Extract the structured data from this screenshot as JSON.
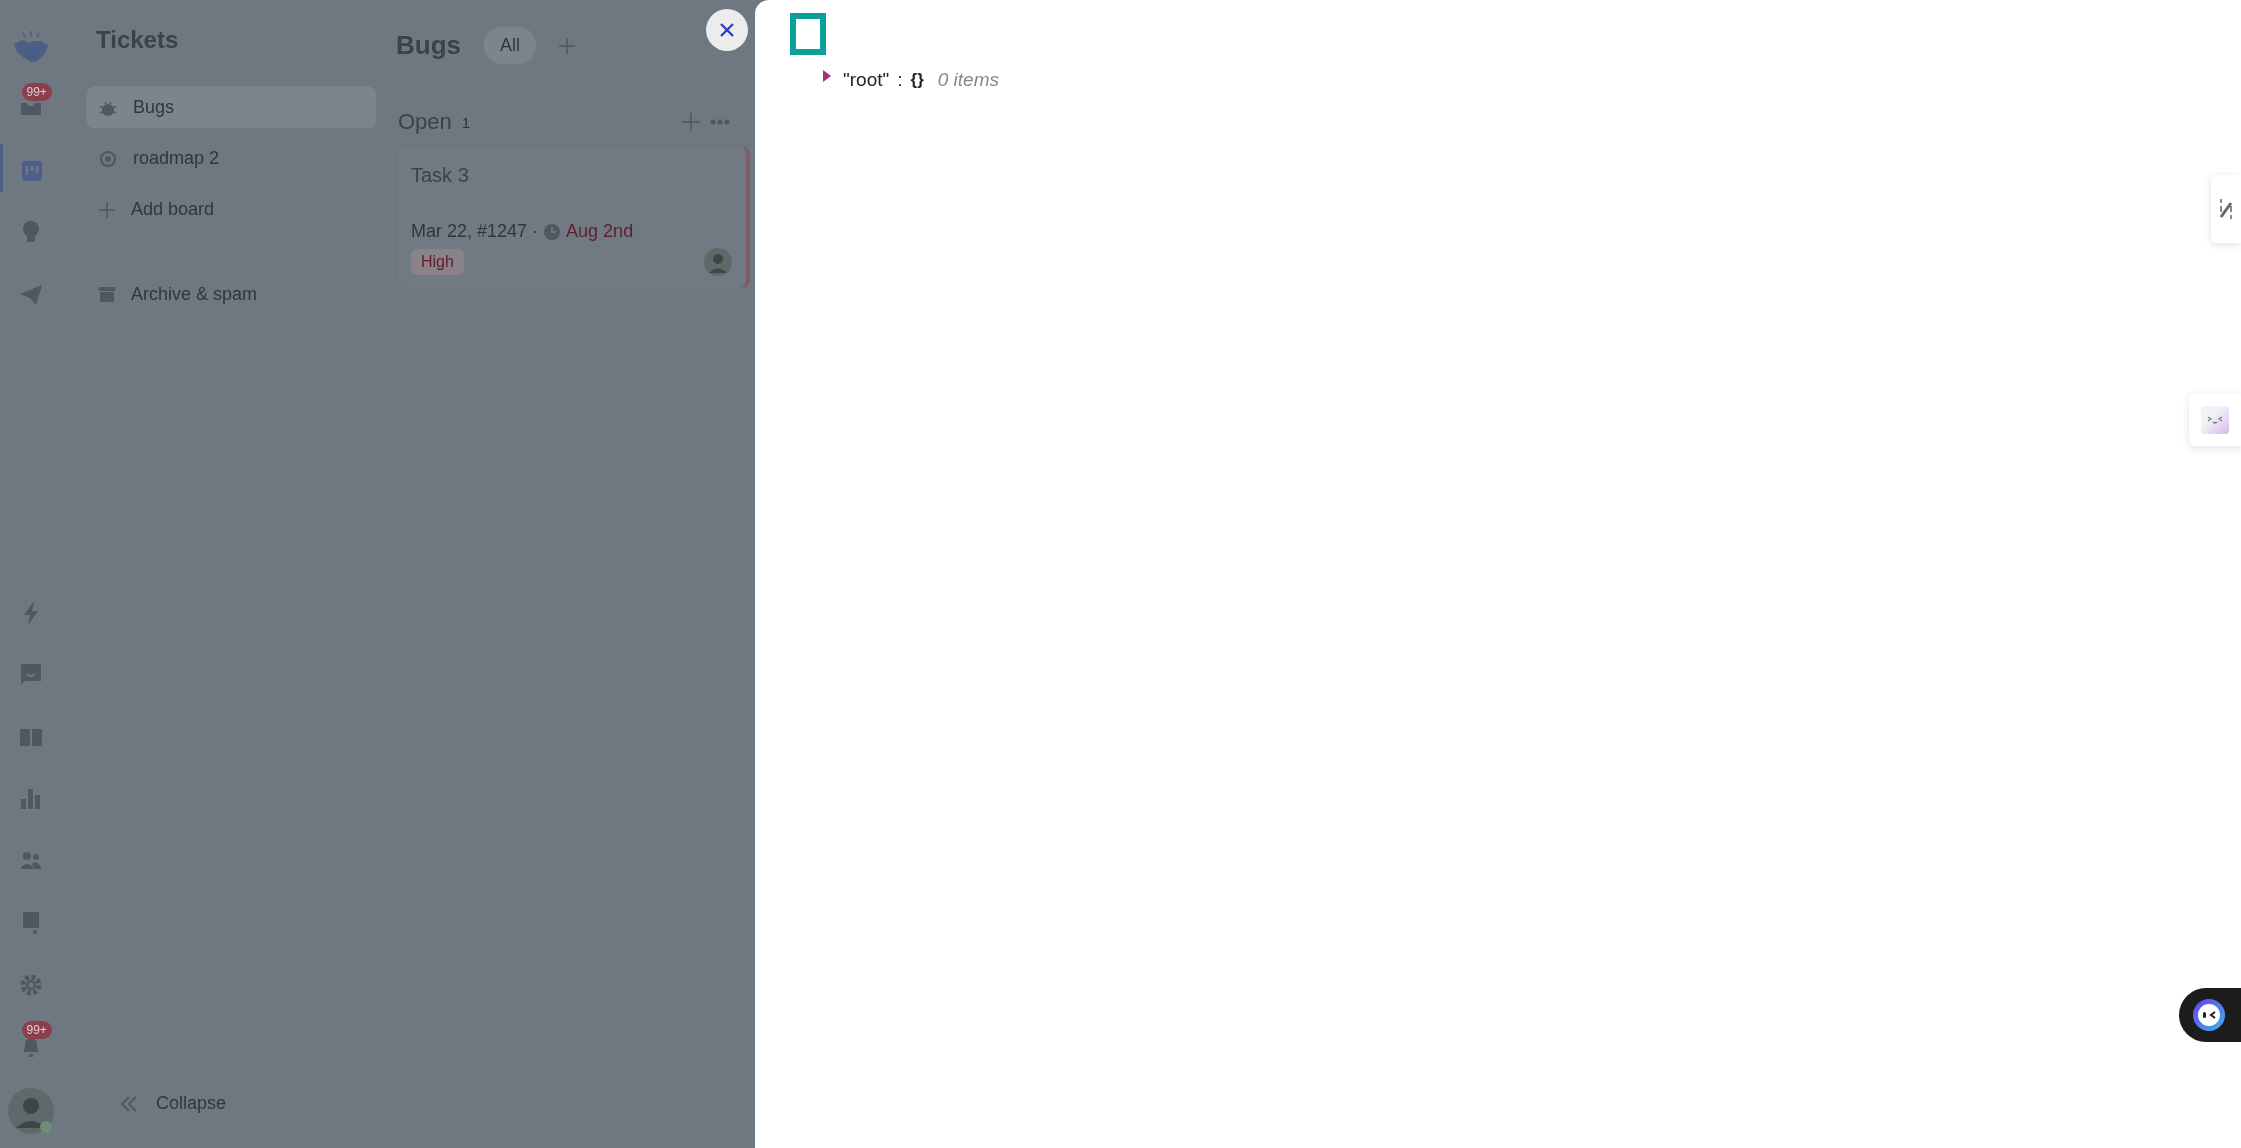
{
  "rail": {
    "top_items": [
      {
        "kind": "logo",
        "selected": false
      },
      {
        "kind": "inbox",
        "badge": "99+",
        "selected": false
      },
      {
        "kind": "board",
        "selected": true
      },
      {
        "kind": "bulb",
        "selected": false
      },
      {
        "kind": "send",
        "selected": false
      }
    ],
    "bottom_items": [
      {
        "kind": "bolt",
        "selected": false
      },
      {
        "kind": "chat",
        "selected": false
      },
      {
        "kind": "book",
        "selected": false
      },
      {
        "kind": "chart",
        "selected": false
      },
      {
        "kind": "people",
        "selected": false
      },
      {
        "kind": "note",
        "selected": false
      },
      {
        "kind": "gear",
        "selected": false
      },
      {
        "kind": "bell",
        "badge": "99+",
        "selected": false
      }
    ]
  },
  "sidebar": {
    "title": "Tickets",
    "boards": [
      {
        "kind": "bug",
        "label": "Bugs",
        "selected": true
      },
      {
        "kind": "target",
        "label": "roadmap 2",
        "selected": false
      }
    ],
    "add_board": "Add board",
    "archive": "Archive & spam",
    "collapse": "Collapse"
  },
  "board": {
    "title": "Bugs",
    "views": [
      {
        "label": "All",
        "selected": true
      }
    ],
    "column": {
      "title": "Open",
      "count": "1"
    },
    "card": {
      "title": "Task 3",
      "meta": "Mar 22, #1247 ·",
      "due": "Aug 2nd",
      "priority": "High"
    }
  },
  "viewer": {
    "root": {
      "key": "\"root\"",
      "separator": ":",
      "value": "{}",
      "count": "0 items",
      "expanded": false
    }
  }
}
